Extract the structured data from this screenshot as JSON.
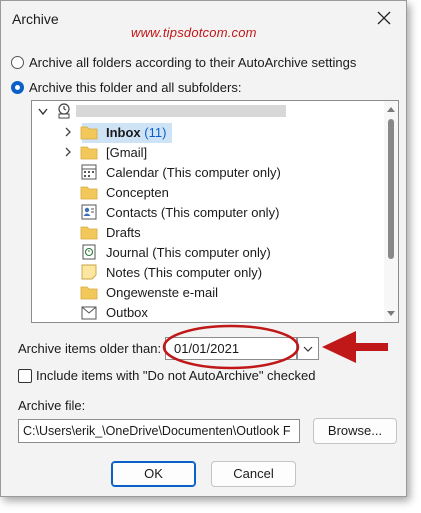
{
  "dialog": {
    "title": "Archive",
    "close_icon": "close-icon"
  },
  "watermark": "www.tipsdotcom.com",
  "options": {
    "all_folders_label": "Archive all folders according to their AutoArchive settings",
    "this_folder_label": "Archive this folder and all subfolders:",
    "selected": "this_folder"
  },
  "tree": {
    "items": [
      {
        "label": "Inbox",
        "count": "(11)",
        "icon": "folder-icon",
        "expander": "chevron-right-icon",
        "bold": true,
        "selected": true
      },
      {
        "label": "[Gmail]",
        "count": "",
        "icon": "folder-icon",
        "expander": "chevron-right-icon"
      },
      {
        "label": "Calendar (This computer only)",
        "count": "",
        "icon": "calendar-icon",
        "expander": ""
      },
      {
        "label": "Concepten",
        "count": "",
        "icon": "folder-icon",
        "expander": ""
      },
      {
        "label": "Contacts (This computer only)",
        "count": "",
        "icon": "contacts-icon",
        "expander": ""
      },
      {
        "label": "Drafts",
        "count": "",
        "icon": "folder-icon",
        "expander": ""
      },
      {
        "label": "Journal (This computer only)",
        "count": "",
        "icon": "journal-icon",
        "expander": ""
      },
      {
        "label": "Notes (This computer only)",
        "count": "",
        "icon": "notes-icon",
        "expander": ""
      },
      {
        "label": "Ongewenste e-mail",
        "count": "",
        "icon": "folder-icon",
        "expander": ""
      },
      {
        "label": "Outbox",
        "count": "",
        "icon": "outbox-icon",
        "expander": ""
      }
    ]
  },
  "archive_older": {
    "label": "Archive items older than:",
    "value": "01/01/2021"
  },
  "include_checkbox": {
    "label": "Include items with \"Do not AutoArchive\" checked",
    "checked": false
  },
  "archive_file": {
    "label": "Archive file:",
    "value": "C:\\Users\\erik_\\OneDrive\\Documenten\\Outlook F",
    "browse_label": "Browse..."
  },
  "buttons": {
    "ok": "OK",
    "cancel": "Cancel"
  },
  "colors": {
    "accent": "#0a60c8",
    "annotation_red": "#c01818",
    "folder": "#f2c85b"
  }
}
